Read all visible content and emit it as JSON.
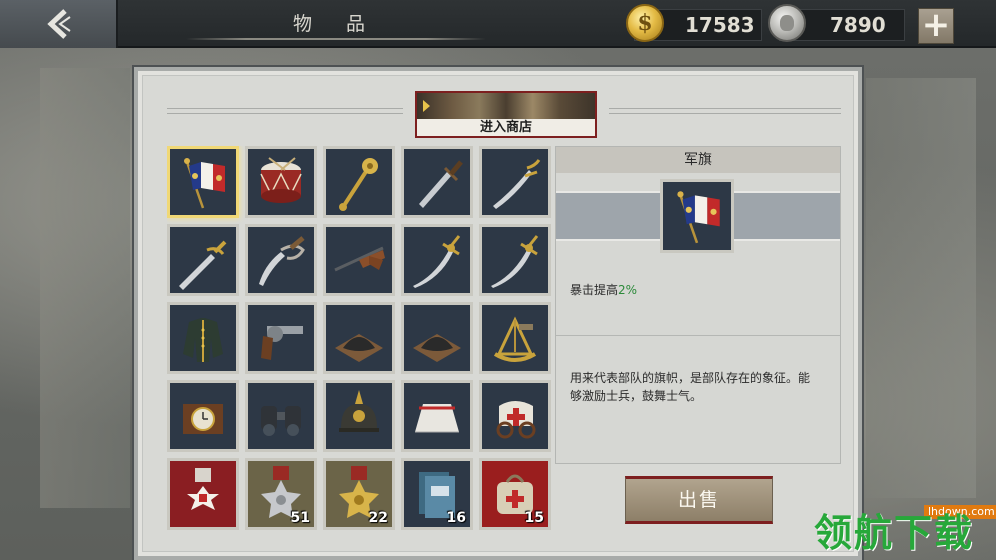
{
  "header": {
    "title": "物 品",
    "gold": {
      "icon": "gold-coin-icon",
      "value": "17583"
    },
    "silver": {
      "icon": "silver-medal-icon",
      "value": "7890"
    },
    "back_icon": "back-chevron-icon",
    "add_icon": "plus-icon"
  },
  "shop": {
    "label": "进入商店"
  },
  "items": [
    {
      "name": "flag",
      "icon": "flag-icon",
      "selected": true,
      "count": ""
    },
    {
      "name": "drum",
      "icon": "drum-icon",
      "count": ""
    },
    {
      "name": "mace",
      "icon": "mace-icon",
      "count": ""
    },
    {
      "name": "dagger",
      "icon": "dagger-icon",
      "count": ""
    },
    {
      "name": "saber",
      "icon": "saber-icon",
      "count": ""
    },
    {
      "name": "sword",
      "icon": "sword-icon",
      "count": ""
    },
    {
      "name": "cutlass",
      "icon": "cutlass-icon",
      "count": ""
    },
    {
      "name": "rifle",
      "icon": "rifle-icon",
      "count": ""
    },
    {
      "name": "scimitar",
      "icon": "scimitar-icon",
      "count": ""
    },
    {
      "name": "scimitar-2",
      "icon": "scimitar-icon",
      "count": ""
    },
    {
      "name": "uniform",
      "icon": "uniform-icon",
      "count": ""
    },
    {
      "name": "revolver",
      "icon": "revolver-icon",
      "count": ""
    },
    {
      "name": "gunpowder",
      "icon": "gunpowder-icon",
      "count": ""
    },
    {
      "name": "gunpowder-2",
      "icon": "gunpowder-icon",
      "count": ""
    },
    {
      "name": "sextant",
      "icon": "sextant-icon",
      "count": ""
    },
    {
      "name": "pocket-watch",
      "icon": "pocket-watch-icon",
      "count": ""
    },
    {
      "name": "binoculars",
      "icon": "binoculars-icon",
      "count": ""
    },
    {
      "name": "helmet",
      "icon": "spiked-helmet-icon",
      "count": ""
    },
    {
      "name": "tent",
      "icon": "tent-icon",
      "count": ""
    },
    {
      "name": "ambulance-cart",
      "icon": "ambulance-cart-icon",
      "count": ""
    },
    {
      "name": "red-medal",
      "icon": "red-cross-medal-icon",
      "count": ""
    },
    {
      "name": "silver-star-medal",
      "icon": "silver-star-medal-icon",
      "count": "51"
    },
    {
      "name": "gold-star-medal",
      "icon": "gold-star-medal-icon",
      "count": "22"
    },
    {
      "name": "books",
      "icon": "books-icon",
      "count": "16"
    },
    {
      "name": "medical-bag",
      "icon": "medical-bag-icon",
      "count": "15"
    }
  ],
  "detail": {
    "title": "军旗",
    "icon": "flag-icon",
    "stat_label": "暴击提高",
    "stat_value": "2%",
    "description": "用来代表部队的旗帜，是部队存在的象征。能够激励士兵，鼓舞士气。",
    "colors": {
      "stat": "#2c8a3a"
    }
  },
  "sell": {
    "label": "出售"
  },
  "watermark": {
    "url": "lhdown.com",
    "text": "领航下载"
  }
}
